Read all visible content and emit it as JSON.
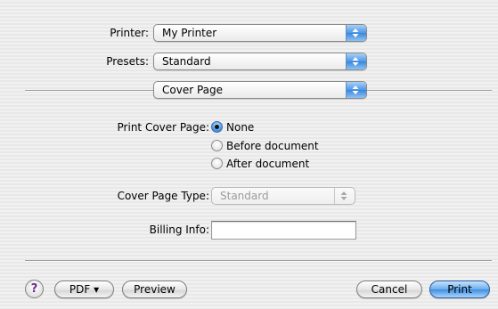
{
  "printer": {
    "label": "Printer:",
    "value": "My Printer"
  },
  "presets": {
    "label": "Presets:",
    "value": "Standard"
  },
  "panel": {
    "value": "Cover Page"
  },
  "cover_page": {
    "label": "Print Cover Page:",
    "options": [
      {
        "label": "None",
        "selected": true
      },
      {
        "label": "Before document",
        "selected": false
      },
      {
        "label": "After document",
        "selected": false
      }
    ]
  },
  "cover_page_type": {
    "label": "Cover Page Type:",
    "value": "Standard",
    "disabled": true
  },
  "billing_info": {
    "label": "Billing Info:",
    "value": ""
  },
  "buttons": {
    "help": "?",
    "pdf": "PDF ▾",
    "preview": "Preview",
    "cancel": "Cancel",
    "print": "Print"
  },
  "colors": {
    "accent": "#3f8ddf",
    "disabled_text": "#9c9c9c"
  }
}
